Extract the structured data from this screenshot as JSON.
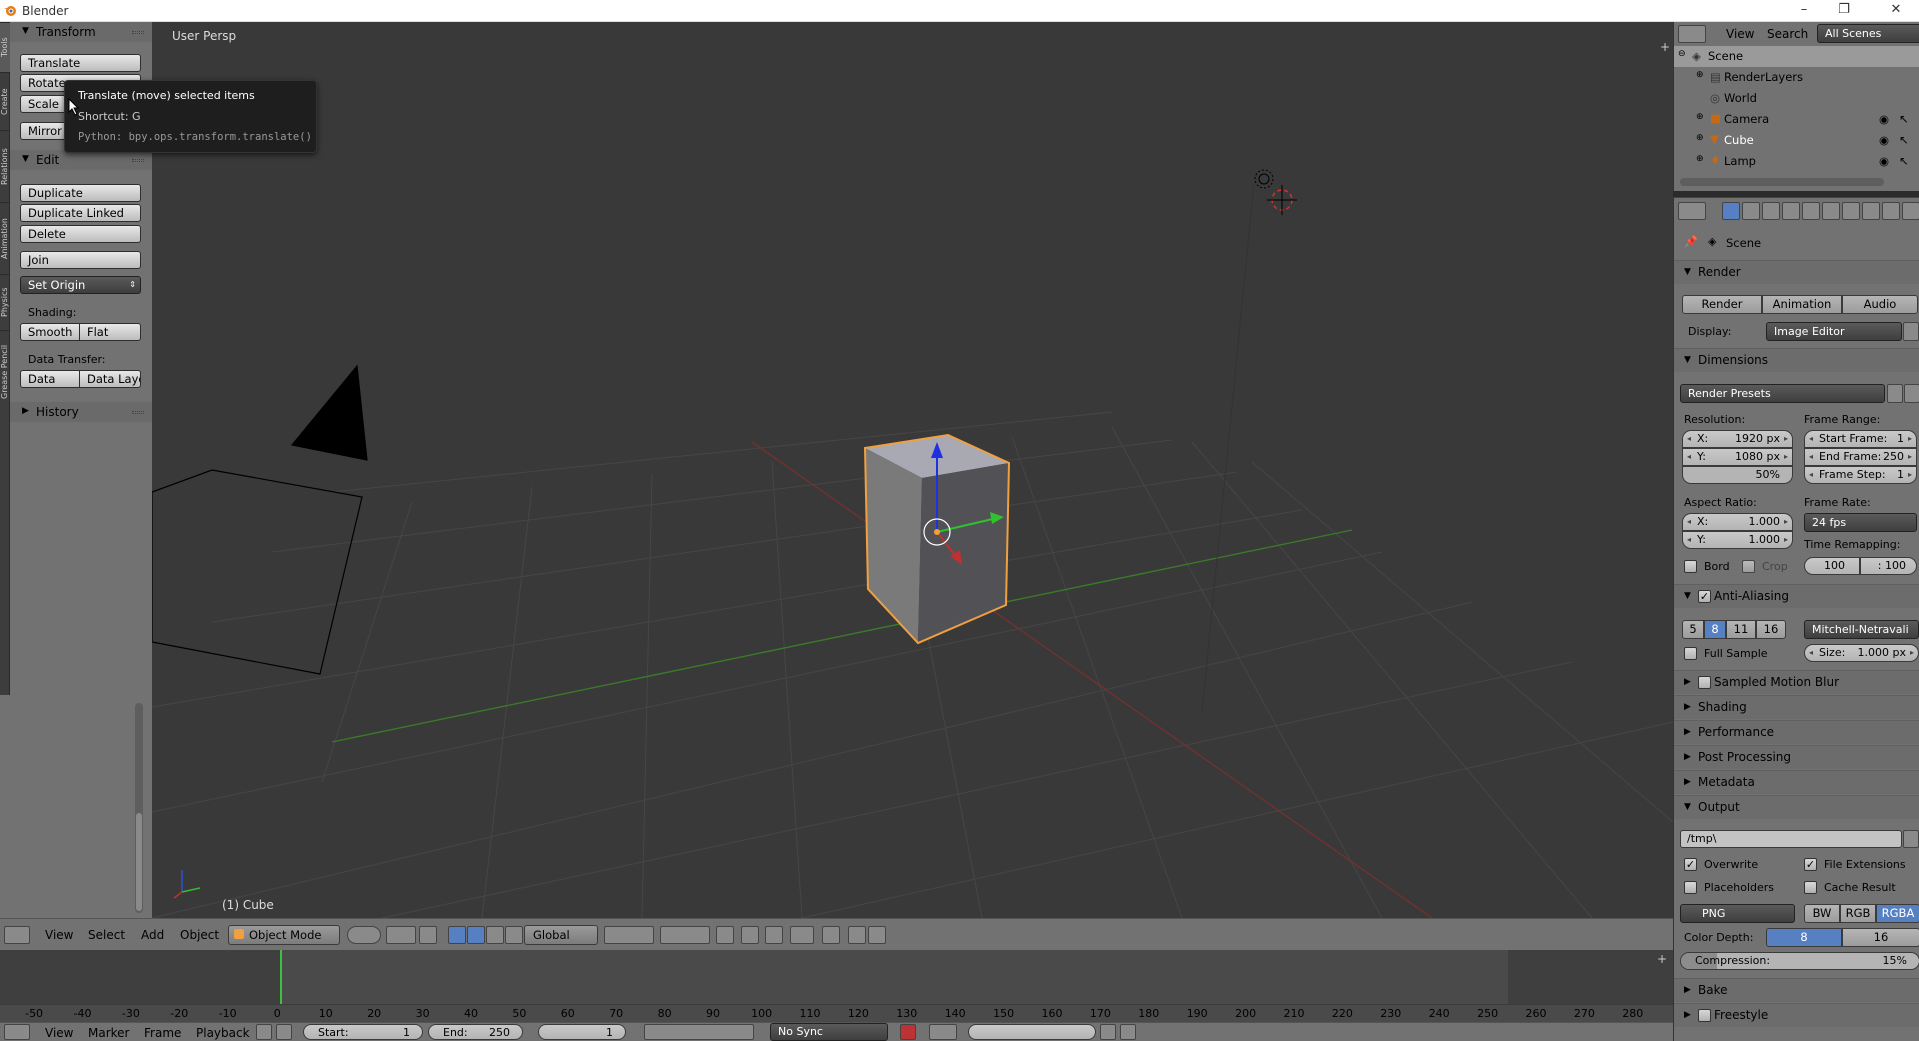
{
  "window": {
    "title": "Blender"
  },
  "left_tabs": [
    "Tools",
    "Create",
    "Relations",
    "Animation",
    "Physics",
    "Grease Pencil"
  ],
  "toolshelf": {
    "transform_header": "Transform",
    "translate": "Translate",
    "rotate": "Rotate",
    "scale": "Scale",
    "mirror": "Mirror",
    "edit_header": "Edit",
    "duplicate": "Duplicate",
    "duplicate_linked": "Duplicate Linked",
    "delete": "Delete",
    "join": "Join",
    "set_origin": "Set Origin",
    "shading_label": "Shading:",
    "smooth": "Smooth",
    "flat": "Flat",
    "data_transfer_label": "Data Transfer:",
    "data": "Data",
    "data_layo": "Data Layo",
    "history_header": "History"
  },
  "tooltip": {
    "title": "Translate (move) selected items",
    "shortcut": "Shortcut: G",
    "python": "Python: bpy.ops.transform.translate()"
  },
  "viewport": {
    "view_label": "User Persp",
    "object_label": "(1) Cube"
  },
  "view3d_header": {
    "menus": [
      "View",
      "Select",
      "Add",
      "Object"
    ],
    "mode": "Object Mode",
    "orientation": "Global"
  },
  "timeline": {
    "ticks": [
      "-50",
      "-40",
      "-30",
      "-20",
      "-10",
      "0",
      "10",
      "20",
      "30",
      "40",
      "50",
      "60",
      "70",
      "80",
      "90",
      "100",
      "110",
      "120",
      "130",
      "140",
      "150",
      "160",
      "170",
      "180",
      "190",
      "200",
      "210",
      "220",
      "230",
      "240",
      "250",
      "260",
      "270",
      "280"
    ],
    "menus": [
      "View",
      "Marker",
      "Frame",
      "Playback"
    ],
    "start": "Start:",
    "start_val": "1",
    "end": "End:",
    "end_val": "250",
    "current": "1",
    "sync": "No Sync"
  },
  "outliner": {
    "header_view": "View",
    "header_search": "Search",
    "header_scenes": "All Scenes",
    "items": [
      "Scene",
      "RenderLayers",
      "World",
      "Camera",
      "Cube",
      "Lamp"
    ]
  },
  "properties": {
    "scene_label": "Scene",
    "render_header": "Render",
    "render_btn": "Render",
    "animation_btn": "Animation",
    "audio_btn": "Audio",
    "display_label": "Display:",
    "display_value": "Image Editor",
    "dimensions_header": "Dimensions",
    "render_presets": "Render Presets",
    "resolution_label": "Resolution:",
    "res_x_key": "X:",
    "res_x": "1920 px",
    "res_y_key": "Y:",
    "res_y": "1080 px",
    "res_pct": "50%",
    "frame_range_label": "Frame Range:",
    "start_frame_key": "Start Frame:",
    "start_frame": "1",
    "end_frame_key": "End Frame:",
    "end_frame": "250",
    "frame_step_key": "Frame Step:",
    "frame_step": "1",
    "aspect_label": "Aspect Ratio:",
    "asp_x_key": "X:",
    "asp_x": "1.000",
    "asp_y_key": "Y:",
    "asp_y": "1.000",
    "frame_rate_label": "Frame Rate:",
    "fps": "24 fps",
    "time_remap_label": "Time Remapping:",
    "remap_old": "100",
    "remap_new": ": 100",
    "bord": "Bord",
    "crop": "Crop",
    "aa_header": "Anti-Aliasing",
    "aa_samples": [
      "5",
      "8",
      "11",
      "16"
    ],
    "aa_filter": "Mitchell-Netravali",
    "full_sample": "Full Sample",
    "size_key": "Size:",
    "size_val": "1.000 px",
    "smb_header": "Sampled Motion Blur",
    "shading_header": "Shading",
    "performance_header": "Performance",
    "post_header": "Post Processing",
    "metadata_header": "Metadata",
    "output_header": "Output",
    "output_path": "/tmp\\",
    "overwrite": "Overwrite",
    "file_ext": "File Extensions",
    "placeholders": "Placeholders",
    "cache_result": "Cache Result",
    "format": "PNG",
    "color_modes": [
      "BW",
      "RGB",
      "RGBA"
    ],
    "color_depth_label": "Color Depth:",
    "depth_8": "8",
    "depth_16": "16",
    "compression_key": "Compression:",
    "compression_val": "15%",
    "compression_fraction": 0.15,
    "bake_header": "Bake",
    "freestyle_header": "Freestyle"
  },
  "colors": {
    "selected_orange": "#f0a040",
    "x_axis": "#c03030",
    "y_axis": "#40c030",
    "z_axis": "#2030e0",
    "active_blue": "#5680c2"
  }
}
